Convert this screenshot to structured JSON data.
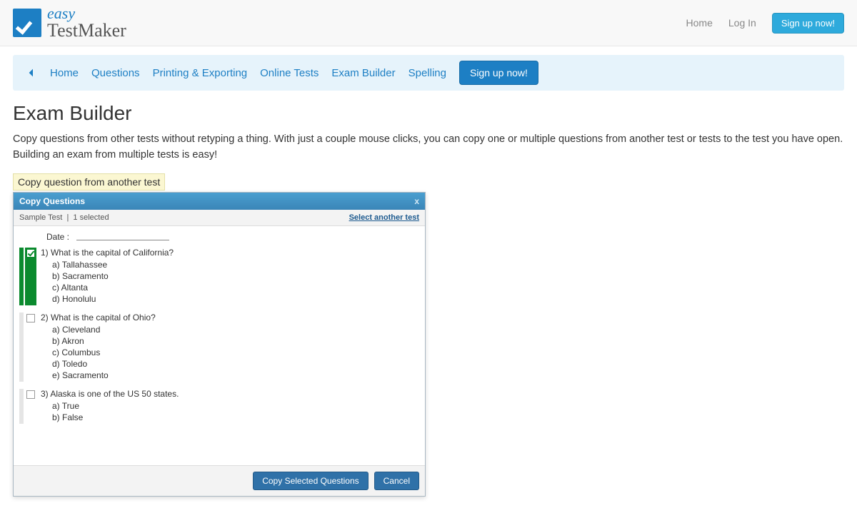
{
  "header": {
    "logo_easy": "easy",
    "logo_maker": "TestMaker",
    "home": "Home",
    "login": "Log In",
    "signup": "Sign up now!"
  },
  "nav": {
    "items": [
      "Home",
      "Questions",
      "Printing & Exporting",
      "Online Tests",
      "Exam Builder",
      "Spelling"
    ],
    "signup": "Sign up now!"
  },
  "page": {
    "title": "Exam Builder",
    "desc": "Copy questions from other tests without retyping a thing. With just a couple mouse clicks, you can copy one or multiple questions from another test or tests to the test you have open. Building an exam from multiple tests is easy!",
    "caption": "Copy question from another test"
  },
  "dialog": {
    "title": "Copy Questions",
    "close": "x",
    "test_name": "Sample Test",
    "selected_suffix": "1 selected",
    "select_another": "Select another test",
    "date_label": "Date :",
    "copy_btn": "Copy Selected Questions",
    "cancel_btn": "Cancel",
    "questions": [
      {
        "selected": true,
        "num": "1)",
        "text": "What is the capital of California?",
        "options": [
          "a) Tallahassee",
          "b) Sacramento",
          "c) Altanta",
          "d) Honolulu"
        ]
      },
      {
        "selected": false,
        "num": "2)",
        "text": "What is the capital of Ohio?",
        "options": [
          "a) Cleveland",
          "b) Akron",
          "c) Columbus",
          "d) Toledo",
          "e) Sacramento"
        ]
      },
      {
        "selected": false,
        "num": "3)",
        "text": "Alaska is one of the US 50 states.",
        "options": [
          "a) True",
          "b) False"
        ]
      }
    ]
  }
}
